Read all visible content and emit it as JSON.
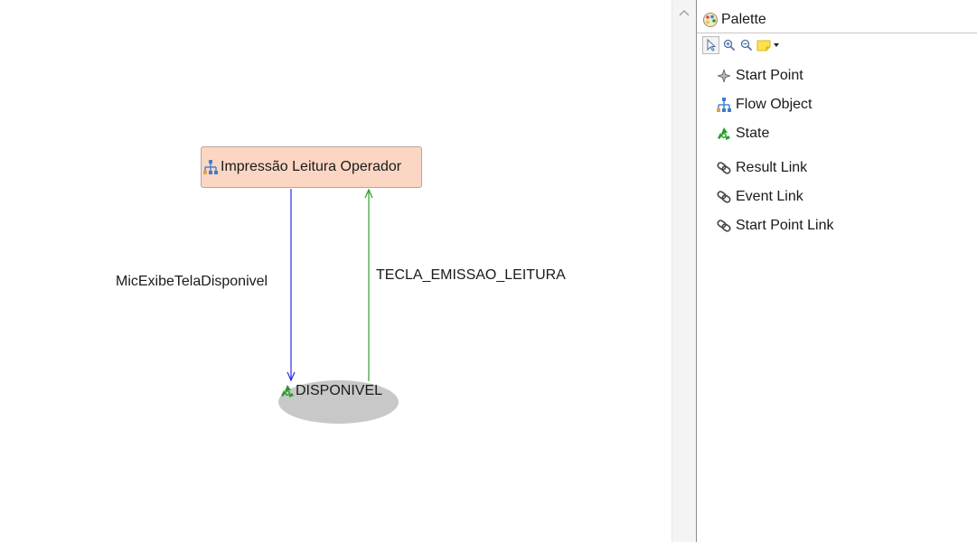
{
  "diagram": {
    "flow_object": {
      "label": "Impressão Leitura Operador",
      "icon": "flow-object-icon"
    },
    "state": {
      "label": "DISPONIVEL",
      "icon": "state-recycle-icon"
    },
    "edges": [
      {
        "label": "MicExibeTelaDisponivel",
        "color": "#2b2bd9"
      },
      {
        "label": "TECLA_EMISSAO_LEITURA",
        "color": "#2f9e2f"
      }
    ]
  },
  "palette": {
    "title": "Palette",
    "toolbar": [
      "select-pointer-icon",
      "zoom-in-icon",
      "zoom-out-icon",
      "note-icon",
      "dropdown-arrow-icon"
    ],
    "items": [
      {
        "label": "Start Point",
        "icon": "start-point-icon"
      },
      {
        "label": "Flow Object",
        "icon": "flow-object-icon"
      },
      {
        "label": "State",
        "icon": "state-recycle-icon"
      },
      {
        "label": "Result Link",
        "icon": "link-icon"
      },
      {
        "label": "Event Link",
        "icon": "link-icon"
      },
      {
        "label": "Start Point Link",
        "icon": "link-icon"
      }
    ]
  },
  "colors": {
    "flow_object_fill": "#fbd6c2",
    "state_fill": "#c8c8c8",
    "state_icon_green": "#2a9d2a"
  }
}
